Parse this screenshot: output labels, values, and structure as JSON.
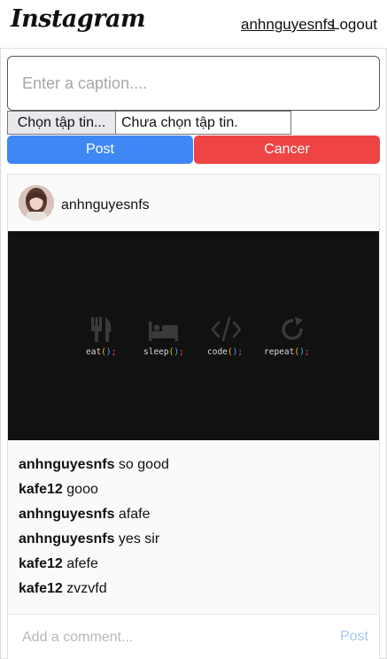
{
  "header": {
    "logo": "Instagram",
    "username": "anhnguyesnfs",
    "logout_label": "Logout"
  },
  "upload": {
    "caption_placeholder": "Enter a caption....",
    "caption_value": "",
    "file_button_label": "Chọn tập tin...",
    "file_status": "Chưa chọn tập tin.",
    "post_label": "Post",
    "cancel_label": "Cancer"
  },
  "post": {
    "author": "anhnguyesnfs",
    "image": {
      "labels": [
        "eat();",
        "sleep();",
        "code();",
        "repeat();"
      ],
      "icons": [
        "fork-knife-icon",
        "bed-icon",
        "code-brackets-icon",
        "refresh-icon"
      ]
    },
    "comments": [
      {
        "user": "anhnguyesnfs",
        "text": "so good"
      },
      {
        "user": "kafe12",
        "text": "gooo"
      },
      {
        "user": "anhnguyesnfs",
        "text": "afafe"
      },
      {
        "user": "anhnguyesnfs",
        "text": "yes sir"
      },
      {
        "user": "kafe12",
        "text": "afefe"
      },
      {
        "user": "kafe12",
        "text": "zvzvfd"
      }
    ],
    "comment_placeholder": "Add a comment...",
    "comment_post_label": "Post"
  },
  "colors": {
    "post_button": "#3f87f5",
    "cancel_button": "#ef4444",
    "image_background": "#111111",
    "label_yellow": "#f0c808",
    "label_blue": "#4aa8ff",
    "label_red": "#ff4b4b"
  }
}
